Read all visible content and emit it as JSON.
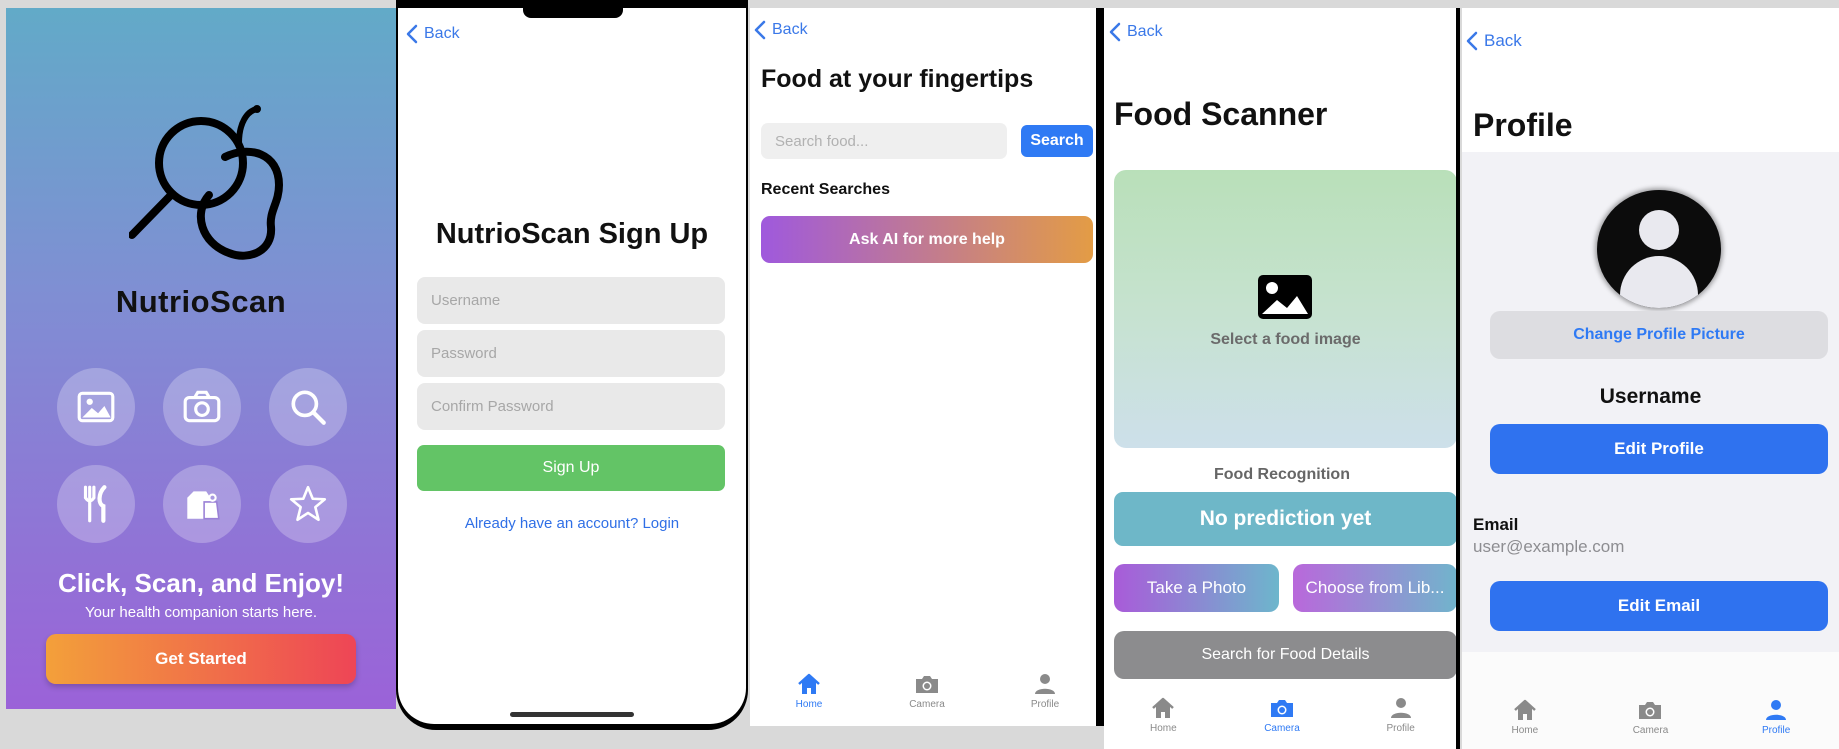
{
  "welcome": {
    "brand": "NutrioScan",
    "tagline": "Click, Scan, and Enjoy!",
    "subtitle": "Your health companion starts here.",
    "get_started": "Get Started",
    "feature_icons": [
      "image-icon",
      "camera-icon",
      "search-icon",
      "utensils-icon",
      "grocery-icon",
      "star-icon"
    ]
  },
  "signup": {
    "back": "Back",
    "title": "NutrioScan Sign Up",
    "username_placeholder": "Username",
    "password_placeholder": "Password",
    "confirm_placeholder": "Confirm Password",
    "signup_button": "Sign Up",
    "login_link": "Already have an account? Login"
  },
  "home": {
    "back": "Back",
    "title": "Food at your fingertips",
    "search_placeholder": "Search food...",
    "search_button": "Search",
    "recent_searches": "Recent Searches",
    "ai_button": "Ask AI for more help"
  },
  "scanner": {
    "back": "Back",
    "title": "Food Scanner",
    "select_image": "Select a food image",
    "recognition_label": "Food Recognition",
    "prediction": "No prediction yet",
    "take_photo": "Take a Photo",
    "choose_library": "Choose from Lib...",
    "search_details": "Search for Food Details"
  },
  "profile": {
    "back": "Back",
    "title": "Profile",
    "change_picture": "Change Profile Picture",
    "username": "Username",
    "edit_profile": "Edit Profile",
    "email_label": "Email",
    "email_value": "user@example.com",
    "edit_email": "Edit Email"
  },
  "tabs": [
    {
      "label": "Home",
      "icon": "home-icon"
    },
    {
      "label": "Camera",
      "icon": "camera-icon"
    },
    {
      "label": "Profile",
      "icon": "person-icon"
    }
  ],
  "colors": {
    "accent_blue": "#2f7af4",
    "signup_green": "#63c466",
    "prediction_teal": "#6eb7c8"
  }
}
